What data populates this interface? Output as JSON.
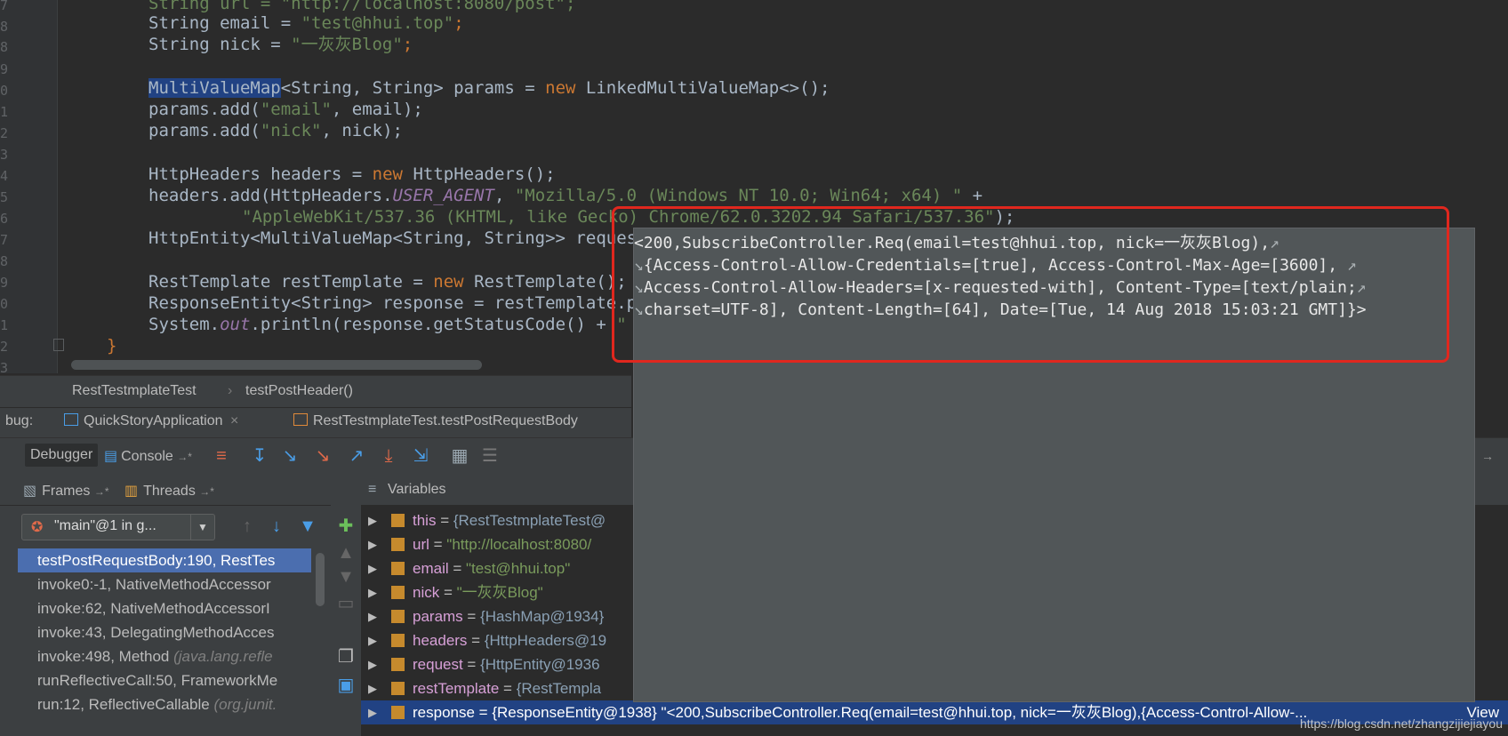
{
  "editor": {
    "line_numbers": [
      "7",
      "8",
      "9",
      "0",
      "1",
      "2",
      "3",
      "4",
      "5",
      "6",
      "7",
      "8",
      "9",
      "0",
      "1",
      "2",
      "3"
    ],
    "lines": {
      "l1": "String url = \"http://localhost:8080/post\";",
      "l2a": "String email = ",
      "l2b": "\"test@hhui.top\"",
      "l2c": ";",
      "l3a": "String nick = ",
      "l3b": "\"一灰灰Blog\"",
      "l3c": ";",
      "l5a": "MultiValueMap",
      "l5b": "<String, String> params = ",
      "l5c": "new",
      "l5d": " LinkedMultiValueMap<>();",
      "l6a": "params.add(",
      "l6b": "\"email\"",
      "l6c": ", email);",
      "l7a": "params.add(",
      "l7b": "\"nick\"",
      "l7c": ", nick);",
      "l9a": "HttpHeaders headers = ",
      "l9b": "new",
      "l9c": " HttpHeaders();",
      "l10a": "headers.add(HttpHeaders.",
      "l10b": "USER_AGENT",
      "l10c": ", ",
      "l10d": "\"Mozilla/5.0 (Windows NT 10.0; Win64; x64) \"",
      "l10e": " +",
      "l11a": "\"AppleWebKit/537.36 (KHTML, like Gecko) Chrome/62.0.3202.94 Safari/537.36\"",
      "l11b": ");",
      "l12a": "HttpEntity<MultiValueMap<String, String>> reques",
      "l14a": "RestTemplate restTemplate = ",
      "l14b": "new",
      "l14c": " RestTemplate();",
      "l15a": "ResponseEntity<String> response = restTemplate.p",
      "l16a": "System.",
      "l16b": "out",
      "l16c": ".println(response.getStatusCode() + ",
      "l16d": "\"",
      "l17a": "}"
    }
  },
  "breadcrumb": {
    "class": "RestTestmplateTest",
    "sep": "›",
    "method": "testPostHeader()"
  },
  "debug_tabs": {
    "label": "bug:",
    "tab1": "QuickStoryApplication",
    "tab1_close": "×",
    "tab2": "RestTestmplateTest.testPostRequestBody"
  },
  "toolbar": {
    "debugger": "Debugger",
    "console": "Console",
    "console_arrow": "→*"
  },
  "frames_pane": {
    "frames_tab": "Frames",
    "frames_arrow": "→*",
    "threads_tab": "Threads",
    "threads_arrow": "→*",
    "thread_selector": "\"main\"@1 in g...",
    "frames": [
      {
        "text": "testPostRequestBody:190, RestTes",
        "pkg": ""
      },
      {
        "text": "invoke0:-1, NativeMethodAccessor",
        "pkg": ""
      },
      {
        "text": "invoke:62, NativeMethodAccessorI",
        "pkg": ""
      },
      {
        "text": "invoke:43, DelegatingMethodAcces",
        "pkg": ""
      },
      {
        "text": "invoke:498, Method ",
        "pkg": "(java.lang.refle"
      },
      {
        "text": "runReflectiveCall:50, FrameworkMe",
        "pkg": ""
      },
      {
        "text": "run:12, ReflectiveCallable ",
        "pkg": "(org.junit."
      }
    ]
  },
  "variables_pane": {
    "title": "Variables",
    "vars": [
      {
        "name": "this",
        "value": "{RestTestmplateTest@",
        "kind": "obj"
      },
      {
        "name": "url",
        "value": "\"http://localhost:8080/",
        "kind": "str"
      },
      {
        "name": "email",
        "value": "\"test@hhui.top\"",
        "kind": "str"
      },
      {
        "name": "nick",
        "value": "\"一灰灰Blog\"",
        "kind": "str"
      },
      {
        "name": "params",
        "value": "{HashMap@1934}",
        "kind": "obj"
      },
      {
        "name": "headers",
        "value": "{HttpHeaders@19",
        "kind": "obj"
      },
      {
        "name": "request",
        "value": "{HttpEntity@1936",
        "kind": "obj"
      },
      {
        "name": "restTemplate",
        "value": "{RestTempla",
        "kind": "obj"
      },
      {
        "name": "response",
        "value": "{ResponseEntity@1938} \"<200,SubscribeController.Req(email=test@hhui.top, nick=一灰灰Blog),{Access-Control-Allow-...",
        "kind": "obj"
      }
    ],
    "view_link": "View"
  },
  "popup": {
    "lines": [
      "<200,SubscribeController.Req(email=test@hhui.top, nick=一灰灰Blog),",
      "{Access-Control-Allow-Credentials=[true], Access-Control-Max-Age=[3600], ",
      "Access-Control-Allow-Headers=[x-requested-with], Content-Type=[text/plain;",
      "charset=UTF-8], Content-Length=[64], Date=[Tue, 14 Aug 2018 15:03:21 GMT]}>"
    ],
    "wrap_end": "↗",
    "wrap_start": "↘"
  },
  "watermark": "https://blog.csdn.net/zhangzijiejiayou",
  "colors": {
    "highlight_box": "#e0271e",
    "selection": "#4b6eaf",
    "keyword": "#cc7832",
    "string": "#6a8759"
  }
}
